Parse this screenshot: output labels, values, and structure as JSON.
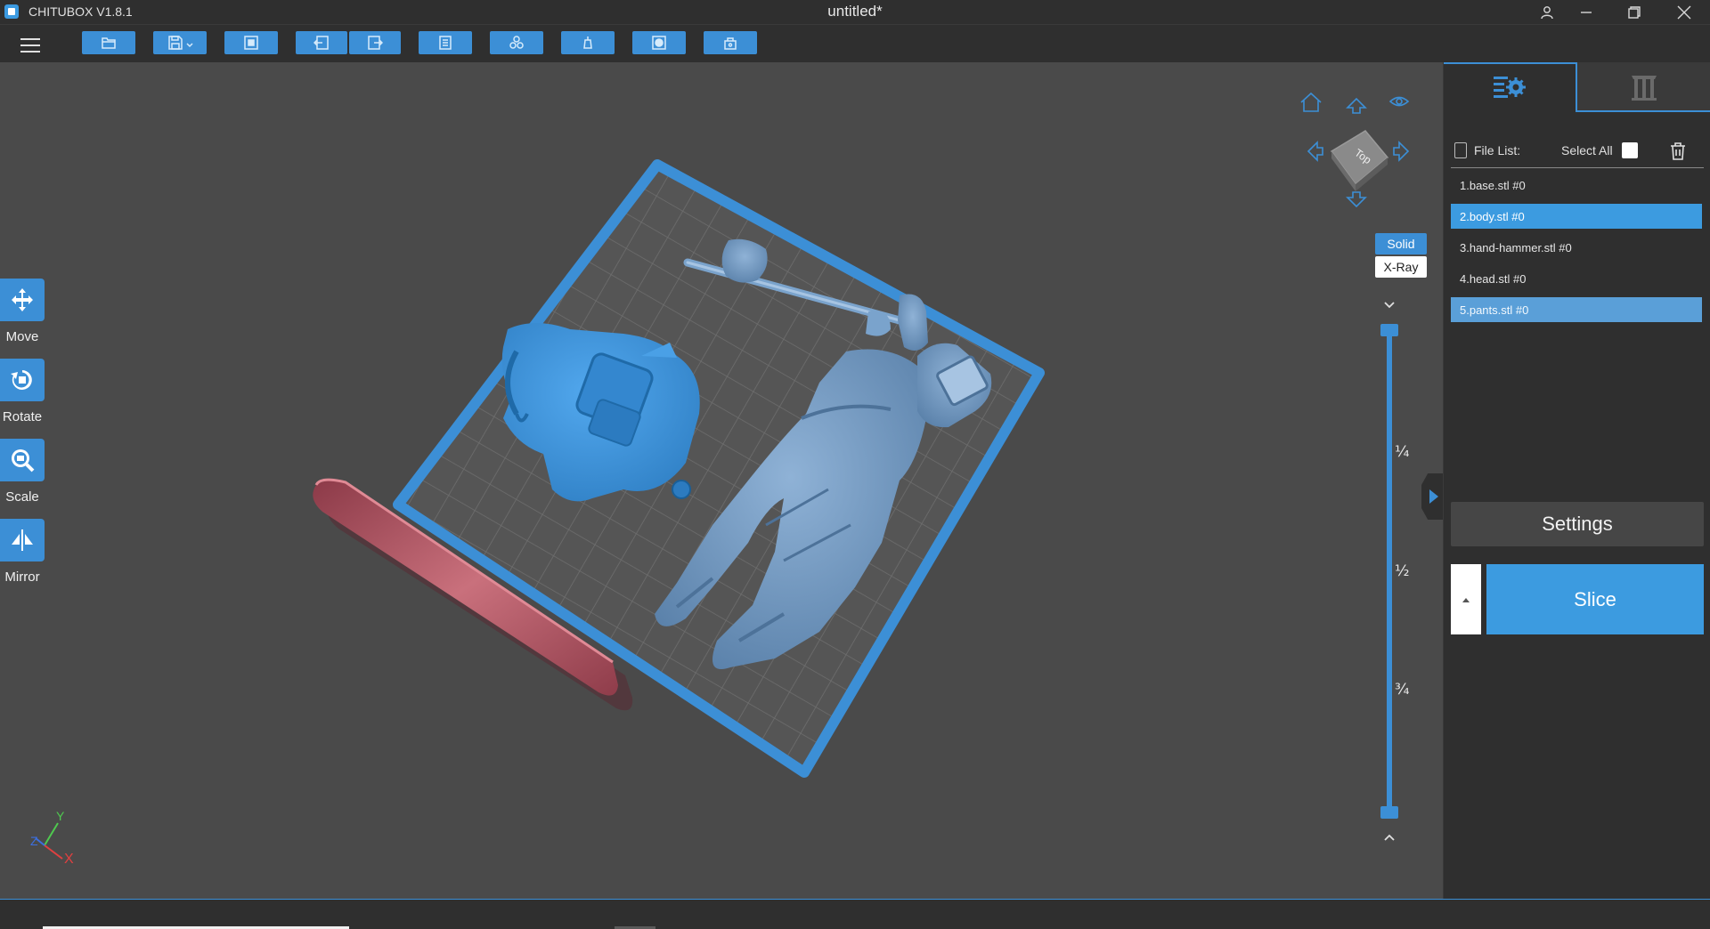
{
  "titlebar": {
    "app_name": "CHITUBOX V1.8.1",
    "document_title": "untitled*"
  },
  "toolbar": {
    "buttons": [
      "open-file",
      "save",
      "auto-layout",
      "undo",
      "redo",
      "task-list",
      "arrange",
      "support",
      "hollow",
      "dig-hole"
    ]
  },
  "left_tools": [
    {
      "label": "Move",
      "icon": "move-icon"
    },
    {
      "label": "Rotate",
      "icon": "rotate-icon"
    },
    {
      "label": "Scale",
      "icon": "scale-icon"
    },
    {
      "label": "Mirror",
      "icon": "mirror-icon"
    }
  ],
  "viewport": {
    "navcube_face": "Top",
    "render_modes": {
      "solid": "Solid",
      "xray": "X-Ray",
      "active": "Solid"
    },
    "layer_slider": {
      "marks": [
        "¼",
        "½",
        "¾"
      ]
    },
    "axes": {
      "x": "X",
      "y": "Y",
      "z": "Z"
    }
  },
  "right_panel": {
    "tabs": [
      "settings-tab",
      "supports-tab"
    ],
    "file_list_label": "File List:",
    "select_all_label": "Select All",
    "files": [
      {
        "name": "1.base.stl #0",
        "state": "normal"
      },
      {
        "name": "2.body.stl #0",
        "state": "selected"
      },
      {
        "name": "3.hand-hammer.stl #0",
        "state": "normal"
      },
      {
        "name": "4.head.stl #0",
        "state": "normal"
      },
      {
        "name": "5.pants.stl #0",
        "state": "selected-secondary"
      }
    ],
    "settings_label": "Settings",
    "slice_label": "Slice"
  },
  "colors": {
    "accent": "#3c8fd6",
    "panel_bg": "#2f2f2f",
    "viewport_bg": "#4a4a4a",
    "model_body": "#3a8ed6",
    "model_pants": "#6e95bd",
    "model_base": "#a84f5e"
  }
}
